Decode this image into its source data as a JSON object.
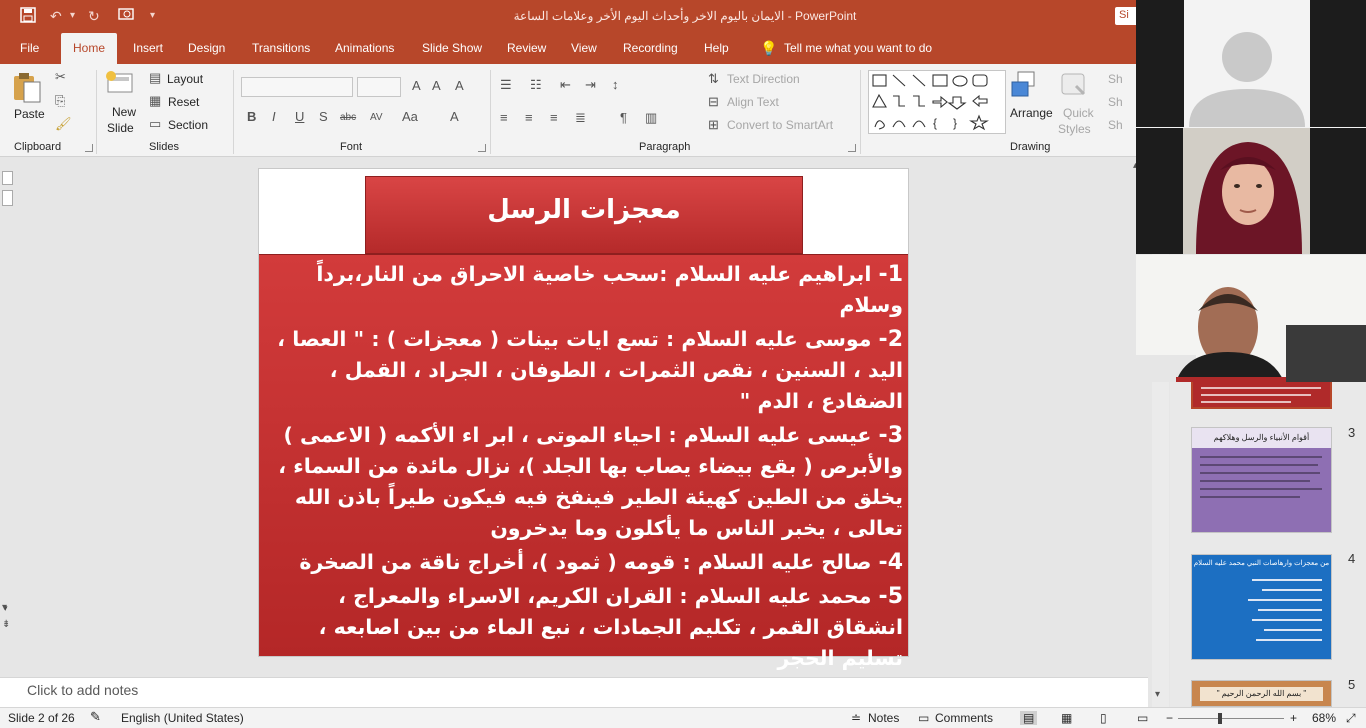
{
  "app": {
    "document_title": "الايمان باليوم الاخر وأحداث اليوم الأخر وعلامات الساعة - PowerPoint",
    "sign_in": "Si"
  },
  "tabs": [
    "File",
    "Home",
    "Insert",
    "Design",
    "Transitions",
    "Animations",
    "Slide Show",
    "Review",
    "View",
    "Recording",
    "Help"
  ],
  "tell_me": "Tell me what you want to do",
  "ribbon": {
    "clipboard": {
      "paste": "Paste",
      "label": "Clipboard"
    },
    "slides": {
      "new_slide_1": "New",
      "new_slide_2": "Slide",
      "layout": "Layout",
      "reset": "Reset",
      "section": "Section",
      "label": "Slides"
    },
    "font": {
      "label": "Font",
      "bold": "B",
      "italic": "I",
      "underline": "U",
      "shadow": "S",
      "strike": "abc",
      "spacing": "AV",
      "case": "Aa",
      "color": "A"
    },
    "paragraph": {
      "text_direction": "Text Direction",
      "align_text": "Align Text",
      "smartart": "Convert to SmartArt",
      "label": "Paragraph"
    },
    "drawing": {
      "arrange": "Arrange",
      "quick_styles_1": "Quick",
      "quick_styles_2": "Styles",
      "label": "Drawing",
      "shape_fill": "Sh",
      "shape_outline": "Sh",
      "shape_effects": "Sh"
    }
  },
  "slide": {
    "title": "معجزات الرسل",
    "points": [
      {
        "num": "1-",
        "text": "ابراهيم عليه السلام :سحب خاصية الاحراق من النار،برداً وسلام"
      },
      {
        "num": "2-",
        "text": "موسى عليه السلام : تسع ايات بينات ( معجزات ) : \" العصا ، اليد ، السنين ، نقص الثمرات ، الطوفان ، الجراد ، القمل ، الضفادع ، الدم \""
      },
      {
        "num": "3-",
        "text": "عيسى عليه السلام : احياء الموتى ، ابر اء الأكمه ( الاعمى ) والأبرص ( بقع بيضاء يصاب بها الجلد )، نزال مائدة من السماء ، يخلق من الطين كهيئة الطير فينفخ فيه فيكون طيراً باذن الله تعالى ، يخبر الناس ما يأكلون وما يدخرون"
      },
      {
        "num": "4-",
        "text": "صالح عليه السلام : قومه ( ثمود )، أخراج ناقة من الصخرة"
      },
      {
        "num": "5-",
        "text": "محمد عليه السلام : القران الكريم، الاسراء والمعراج ، انشقاق القمر ، تكليم الجمادات ، نبع الماء من بين اصابعه ، تسليم الحجر"
      }
    ]
  },
  "notes_placeholder": "Click to add notes",
  "thumbnails": [
    {
      "num": "3",
      "title": "أقوام الأنبياء والرسل وهلاكهم",
      "bg": "#8e6fb3"
    },
    {
      "num": "4",
      "title": "من معجزات وارهاصات النبي محمد عليه السلام",
      "bg": "#1c6fc2"
    },
    {
      "num": "5",
      "title": "\" بسم الله الرحمن الرحيم \"",
      "bg": "#c8864e"
    }
  ],
  "status": {
    "slide_counter": "Slide 2 of 26",
    "language": "English (United States)",
    "notes": "Notes",
    "comments": "Comments",
    "zoom": "68%",
    "minus": "−",
    "plus": "+"
  },
  "colors": {
    "accent": "#b7472a",
    "slide_red": "#c83232"
  }
}
